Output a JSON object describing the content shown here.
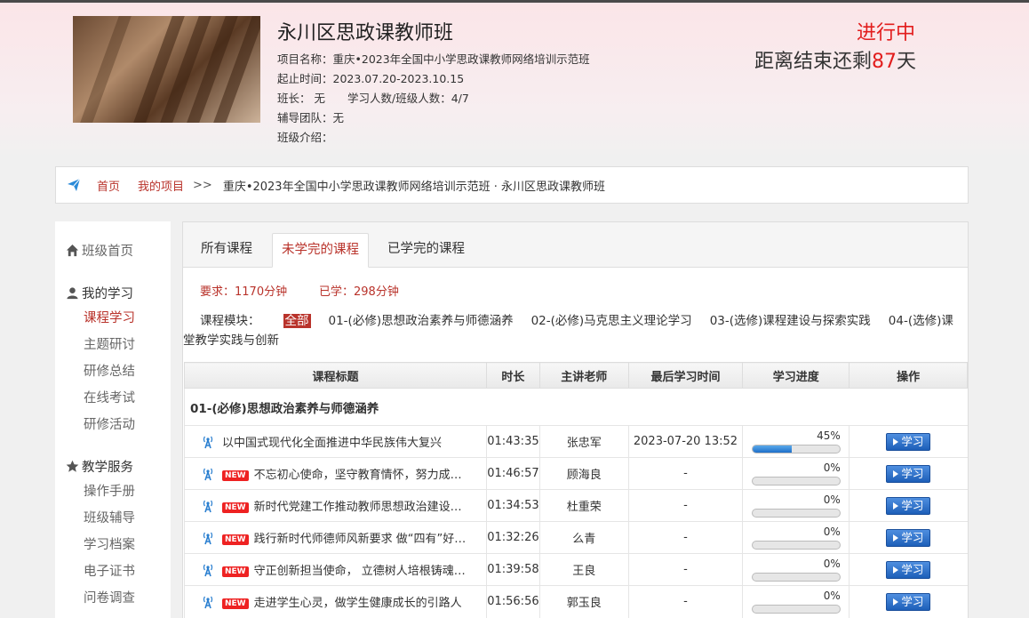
{
  "header": {
    "class_title": "永川区思政课教师班",
    "project": "项目名称：重庆•2023年全国中小学思政课教师网络培训示范班",
    "period": "起止时间：2023.07.20-2023.10.15",
    "monitor": "班长：  无",
    "learners": "学习人数/班级人数：4/7",
    "tutor_team": "辅导团队：无",
    "intro": "班级介绍：",
    "status": "进行中",
    "remain_prefix": "距离结束还剩",
    "remain_days": "87",
    "remain_suffix": "天"
  },
  "breadcrumb": {
    "home": "首页",
    "my_projects": "我的项目",
    "sep": ">>",
    "path": "重庆•2023年全国中小学思政课教师网络培训示范班 · 永川区思政课教师班"
  },
  "sidebar": {
    "class_home": "班级首页",
    "my_learning": "我的学习",
    "learning_items": [
      "课程学习",
      "主题研讨",
      "研修总结",
      "在线考试",
      "研修活动"
    ],
    "teaching_service": "教学服务",
    "service_items": [
      "操作手册",
      "班级辅导",
      "学习档案",
      "电子证书",
      "问卷调查"
    ]
  },
  "tabs": [
    "所有课程",
    "未学完的课程",
    "已学完的课程"
  ],
  "summary": {
    "required": "要求：1170分钟",
    "learned": "已学：298分钟"
  },
  "modules": {
    "label": "课程模块：",
    "all": "全部",
    "items": [
      "01-(必修)思想政治素养与师德涵养",
      "02-(必修)马克思主义理论学习",
      "03-(选修)课程建设与探索实践",
      "04-(选修)课堂教学实践与创新"
    ]
  },
  "table": {
    "headers": [
      "课程标题",
      "时长",
      "主讲老师",
      "最后学习时间",
      "学习进度",
      "操作"
    ],
    "group": "01-(必修)思想政治素养与师德涵养",
    "new_badge": "NEW",
    "action_label": "学习",
    "rows": [
      {
        "title": "以中国式现代化全面推进中华民族伟大复兴",
        "is_new": false,
        "duration": "01:43:35",
        "teacher": "张忠军",
        "last": "2023-07-20 13:52",
        "progress": 45,
        "progress_text": "45%"
      },
      {
        "title": "不忘初心使命，坚守教育情怀，努力成…",
        "is_new": true,
        "duration": "01:46:57",
        "teacher": "顾海良",
        "last": "-",
        "progress": 0,
        "progress_text": "0%"
      },
      {
        "title": "新时代党建工作推动教师思想政治建设…",
        "is_new": true,
        "duration": "01:34:53",
        "teacher": "杜重荣",
        "last": "-",
        "progress": 0,
        "progress_text": "0%"
      },
      {
        "title": "践行新时代师德师风新要求 做“四有”好…",
        "is_new": true,
        "duration": "01:32:26",
        "teacher": "么青",
        "last": "-",
        "progress": 0,
        "progress_text": "0%"
      },
      {
        "title": "守正创新担当使命， 立德树人培根铸魂…",
        "is_new": true,
        "duration": "01:39:58",
        "teacher": "王良",
        "last": "-",
        "progress": 0,
        "progress_text": "0%"
      },
      {
        "title": "走进学生心灵，做学生健康成长的引路人",
        "is_new": true,
        "duration": "01:56:56",
        "teacher": "郭玉良",
        "last": "-",
        "progress": 0,
        "progress_text": "0%"
      }
    ]
  },
  "colors": {
    "accent_red": "#b9332b",
    "status_red": "#e21d1d",
    "button_blue": "#1d5fb8"
  }
}
